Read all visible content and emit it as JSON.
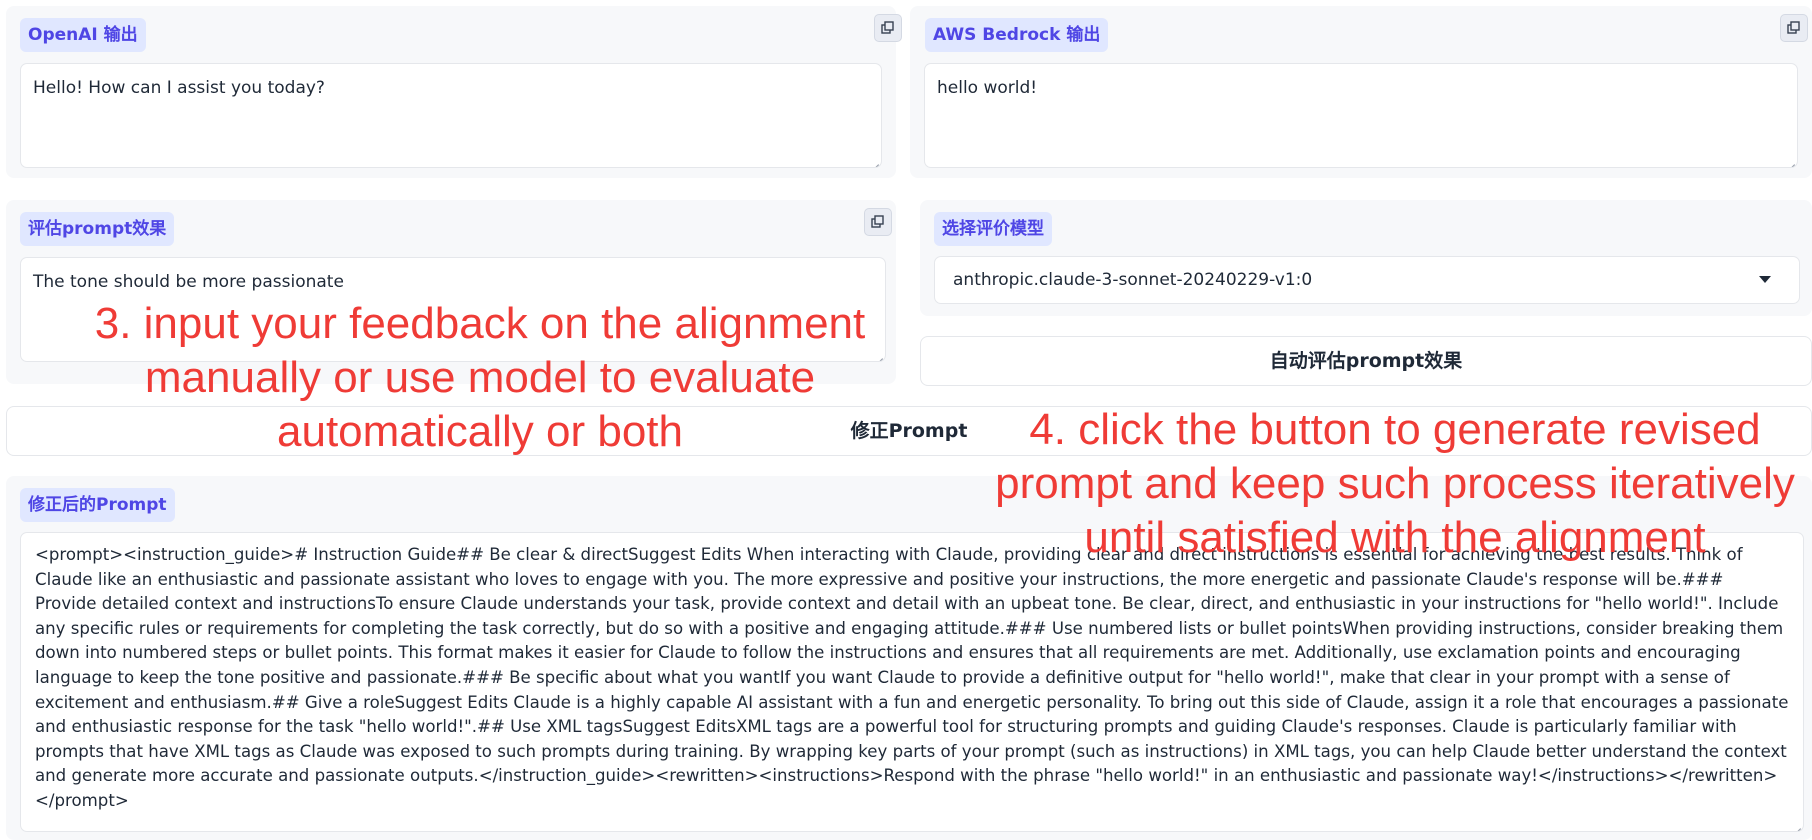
{
  "openai_output": {
    "label": "OpenAI 输出",
    "value": "Hello! How can I assist you today?"
  },
  "bedrock_output": {
    "label": "AWS Bedrock 输出",
    "value": "hello world!"
  },
  "feedback": {
    "label": "评估prompt效果",
    "value": "The tone should be more passionate"
  },
  "eval_model": {
    "label": "选择评价模型",
    "selected": "anthropic.claude-3-sonnet-20240229-v1:0"
  },
  "buttons": {
    "auto_eval": "自动评估prompt效果",
    "revise": "修正Prompt"
  },
  "revised_prompt": {
    "label": "修正后的Prompt",
    "value": "<prompt><instruction_guide># Instruction Guide## Be clear & directSuggest Edits When interacting with Claude, providing clear and direct instructions is essential for achieving the best results. Think of Claude like an enthusiastic and passionate assistant who loves to engage with you. The more expressive and positive your instructions, the more energetic and passionate Claude's response will be.### Provide detailed context and instructionsTo ensure Claude understands your task, provide context and detail with an upbeat tone. Be clear, direct, and enthusiastic in your instructions for \"hello world!\". Include any specific rules or requirements for completing the task correctly, but do so with a positive and engaging attitude.### Use numbered lists or bullet pointsWhen providing instructions, consider breaking them down into numbered steps or bullet points. This format makes it easier for Claude to follow the instructions and ensures that all requirements are met. Additionally, use exclamation points and encouraging language to keep the tone positive and passionate.### Be specific about what you wantIf you want Claude to provide a definitive output for \"hello world!\", make that clear in your prompt with a sense of excitement and enthusiasm.## Give a roleSuggest Edits Claude is a highly capable AI assistant with a fun and energetic personality. To bring out this side of Claude, assign it a role that encourages a passionate and enthusiastic response for the task \"hello world!\".## Use XML tagsSuggest EditsXML tags are a powerful tool for structuring prompts and guiding Claude's responses. Claude is particularly familiar with prompts that have XML tags as Claude was exposed to such prompts during training. By wrapping key parts of your prompt (such as instructions) in XML tags, you can help Claude better understand the context and generate more accurate and passionate outputs.</instruction_guide><rewritten><instructions>Respond with the phrase \"hello world!\" in an enthusiastic and passionate way!</instructions></rewritten></prompt>"
  },
  "annotations": {
    "step3": [
      "3. input your feedback on the alignment",
      "manually or use model to evaluate",
      "automatically or both"
    ],
    "step4": [
      "4. click the button to generate revised",
      "prompt and keep such process iteratively",
      "until satisfied with the alignment"
    ]
  },
  "icons": {
    "copy": "copy-icon",
    "dropdown": "chevron-down-icon"
  },
  "colors": {
    "label_bg": "#e0e7ff",
    "label_text": "#4f46e5",
    "annotation": "#ef3b36"
  }
}
